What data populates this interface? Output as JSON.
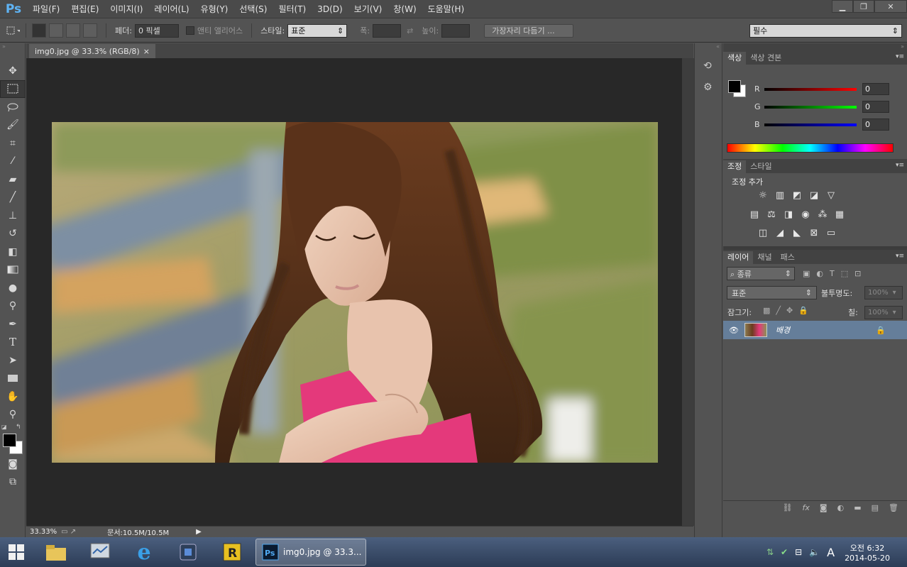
{
  "app": {
    "logo": "Ps"
  },
  "menu": [
    "파일(F)",
    "편집(E)",
    "이미지(I)",
    "레이어(L)",
    "유형(Y)",
    "선택(S)",
    "필터(T)",
    "3D(D)",
    "보기(V)",
    "창(W)",
    "도움말(H)"
  ],
  "window_controls": {
    "minimize": "▁",
    "restore": "❐",
    "close": "✕"
  },
  "options": {
    "feather_label": "페더:",
    "feather_value": "0 픽셀",
    "antialias_label": "앤티 앨리어스",
    "style_label": "스타일:",
    "style_value": "표준",
    "width_label": "폭:",
    "height_label": "높이:",
    "refine_edge": "가장자리 다듬기 ...",
    "workspace": "필수"
  },
  "document": {
    "tab_title": "img0.jpg @ 33.3% (RGB/8)",
    "tab_close": "×",
    "zoom": "33.33%",
    "doc_info": "문서:10.5M/10.5M"
  },
  "color_panel": {
    "tabs": [
      "색상",
      "색상 견본"
    ],
    "r_label": "R",
    "g_label": "G",
    "b_label": "B",
    "r": "0",
    "g": "0",
    "b": "0",
    "foreground": "#000000",
    "background": "#ffffff"
  },
  "adjust_panel": {
    "tabs": [
      "조정",
      "스타일"
    ],
    "heading": "조정 추가"
  },
  "layers_panel": {
    "tabs": [
      "레이어",
      "채널",
      "패스"
    ],
    "filter_label": "종류",
    "blend_mode": "표준",
    "opacity_label": "불투명도:",
    "opacity_value": "100%",
    "lock_label": "잠그기:",
    "fill_label": "칠:",
    "fill_value": "100%",
    "layer_name": "배경"
  },
  "taskbar": {
    "active_window": "img0.jpg @ 33.3...",
    "clock_time": "오전 6:32",
    "clock_date": "2014-05-20",
    "ime": "A"
  }
}
